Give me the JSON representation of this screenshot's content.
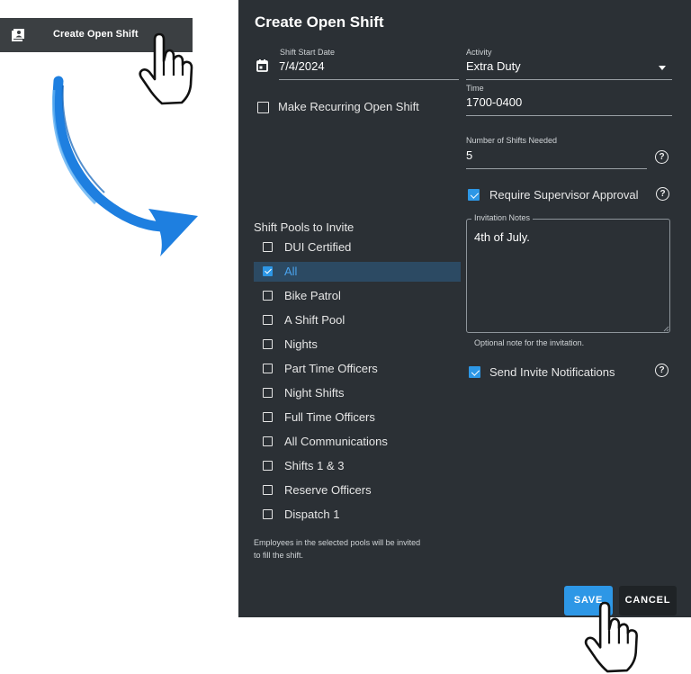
{
  "menu": {
    "label": "Create Open Shift",
    "icon": "person-plus-icon"
  },
  "dialog": {
    "title": "Create Open Shift",
    "shift_start_date": {
      "label": "Shift Start Date",
      "value": "7/4/2024"
    },
    "activity": {
      "label": "Activity",
      "value": "Extra Duty"
    },
    "time": {
      "label": "Time",
      "value": "1700-0400"
    },
    "recurring": {
      "label": "Make Recurring Open Shift",
      "checked": false
    },
    "shifts_needed": {
      "label": "Number of Shifts Needed",
      "value": "5"
    },
    "require_approval": {
      "label": "Require Supervisor Approval",
      "checked": true
    },
    "pools": {
      "heading": "Shift Pools to Invite",
      "items": [
        {
          "label": "DUI Certified",
          "checked": false
        },
        {
          "label": "All",
          "checked": true
        },
        {
          "label": "Bike Patrol",
          "checked": false
        },
        {
          "label": "A Shift Pool",
          "checked": false
        },
        {
          "label": "Nights",
          "checked": false
        },
        {
          "label": "Part Time Officers",
          "checked": false
        },
        {
          "label": "Night Shifts",
          "checked": false
        },
        {
          "label": "Full Time Officers",
          "checked": false
        },
        {
          "label": "All Communications",
          "checked": false
        },
        {
          "label": "Shifts 1 & 3",
          "checked": false
        },
        {
          "label": "Reserve Officers",
          "checked": false
        },
        {
          "label": "Dispatch 1",
          "checked": false
        }
      ],
      "help_line1": "Employees in the selected pools will be invited",
      "help_line2": "to fill the shift."
    },
    "notes": {
      "label": "Invitation Notes",
      "value": "4th of July.",
      "help": "Optional note for the invitation."
    },
    "send_notifications": {
      "label": "Send Invite Notifications",
      "checked": true
    },
    "save_label": "SAVE",
    "cancel_label": "CANCEL"
  },
  "colors": {
    "accent": "#2d97e6",
    "dialog_bg": "#2b3035",
    "arrow": "#1e7fe0"
  }
}
